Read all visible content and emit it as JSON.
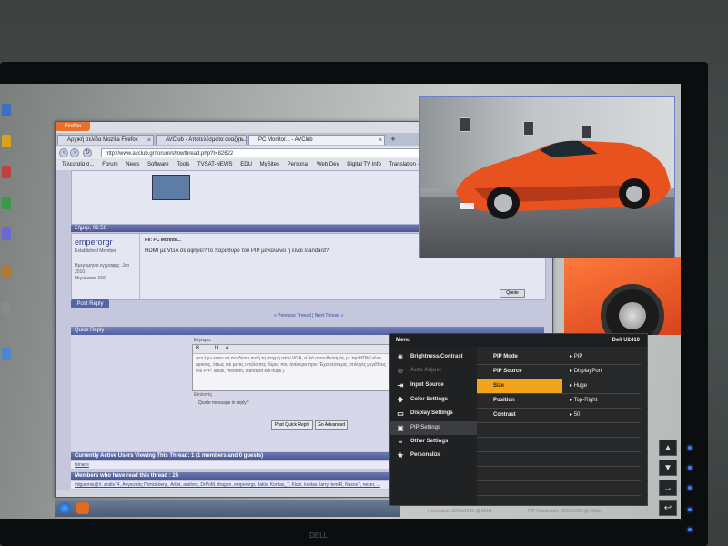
{
  "browser": {
    "app_button": "Firefox",
    "tabs": [
      {
        "label": "Αρχική σελίδα Mozilla Firefox",
        "active": false
      },
      {
        "label": "AVClub - Αποτελέσματα αναζήτ...",
        "active": false
      },
      {
        "label": "PC Monitor... - AVClub",
        "active": true
      }
    ],
    "new_tab": "+",
    "url": "http://www.avclub.gr/forum/showthread.php?t=82622",
    "bookmarks": [
      "Τελευταία σ...",
      "Forum",
      "News",
      "Software",
      "Tools",
      "TVSAT-NEWS",
      "EDU",
      "MySites",
      "Personal",
      "Web Dev",
      "Digital TV Info",
      "Translation - iTran..."
    ]
  },
  "forum": {
    "post_date": "Σήμερ, 01:56",
    "username": "emperorgr",
    "user_title": "Established Member",
    "user_joined": "Ημερομηνία εγγραφής: Jun 2010",
    "user_posts": "Μηνύματα: 166",
    "reply_title": "Re: PC Monitor...",
    "reply_text": "HDMI με VGA σε αφήνει? το παράθυρο του PIP μεγαλώνει η είναι standard?",
    "quote_button": "Quote",
    "post_reply": "Post Reply",
    "nav_links": "« Previous Thread | Next Thread »",
    "quick_reply_title": "Quick Reply",
    "message_label": "Μήνυμα:",
    "toolbar": "B I U A",
    "editor_text": "Δεν έχω κάνει να συνδέσω αυτή τη στιγμή στην VGA, αλλά ο συνδυασμός με την HDMI είναι εφικτός, όπως και με τις υπόλοιπες θύρες που ανέφερα πριν. Έχει τέσσερις επιλογές μεγέθους του PIP: small, medium, standard και huge.)",
    "options_label": "Επιλογές",
    "quote_checkbox": "Quote message in reply?",
    "btn_post": "Post Quick Reply",
    "btn_advanced": "Go Advanced",
    "active_users": "Currently Active Users Viewing This Thread: 1 (1 members and 0 guests)",
    "active_user_name": "tsinaris",
    "readers_title": "Members who have read this thread : 25",
    "readers_list": "#dgiannis@#, andis74, Αγγουπάς Παπαδάκης, Artist, audiors, DrPoM, dragon, emperorgr, Jakis, Kontas_T, Klozi, kostas, larry, lemiR, Nasos7, nexer, ..."
  },
  "monitor": {
    "bezel_label": "DELL"
  },
  "osd": {
    "menu_label": "Menu",
    "model": "Dell U2410",
    "left_items": [
      {
        "label": "Brightness/Contrast",
        "icon": "☀",
        "state": "normal"
      },
      {
        "label": "Auto Adjust",
        "icon": "⊕",
        "state": "dim"
      },
      {
        "label": "Input Source",
        "icon": "⇥",
        "state": "normal"
      },
      {
        "label": "Color Settings",
        "icon": "❖",
        "state": "normal"
      },
      {
        "label": "Display Settings",
        "icon": "▭",
        "state": "normal"
      },
      {
        "label": "PIP Settings",
        "icon": "▣",
        "state": "selected"
      },
      {
        "label": "Other Settings",
        "icon": "≡",
        "state": "normal"
      },
      {
        "label": "Personalize",
        "icon": "★",
        "state": "normal"
      }
    ],
    "right_rows": [
      {
        "label": "PIP Mode",
        "value": "PIP",
        "highlight": false
      },
      {
        "label": "PIP Source",
        "value": "DisplayPort",
        "highlight": false
      },
      {
        "label": "Size",
        "value": "Huge",
        "highlight": true
      },
      {
        "label": "Position",
        "value": "Top-Right",
        "highlight": false
      },
      {
        "label": "Contrast",
        "value": "50",
        "highlight": false
      }
    ],
    "footer_left": "Resolution: 1920x1200 @ 60Hz",
    "footer_right": "PIP Resolution: 1920x1200 @ 60Hz"
  },
  "front_buttons": [
    "▲",
    "▼",
    "→",
    "↩"
  ],
  "colors": {
    "osd_highlight": "#f2a41a",
    "led": "#3f7cff",
    "car_orange": "#e8521f"
  }
}
